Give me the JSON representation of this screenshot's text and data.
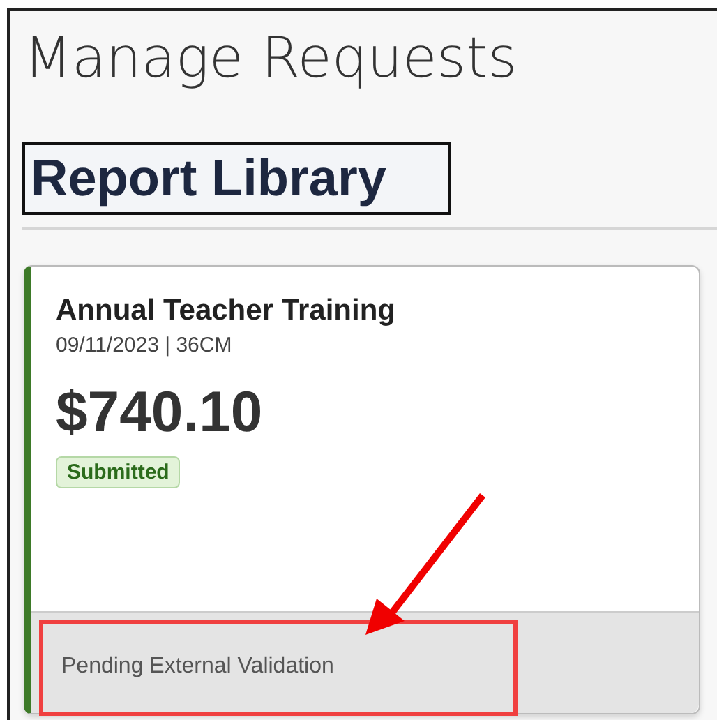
{
  "page": {
    "title": "Manage Requests"
  },
  "section": {
    "title": "Report Library"
  },
  "cards": [
    {
      "title": "Annual Teacher Training",
      "meta": "09/11/2023 | 36CM",
      "amount": "$740.10",
      "status": {
        "label": "Submitted",
        "kind": "success"
      },
      "footer": "Pending External Validation"
    }
  ],
  "annotations": [
    {
      "kind": "highlight"
    },
    {
      "kind": "arrow"
    }
  ]
}
